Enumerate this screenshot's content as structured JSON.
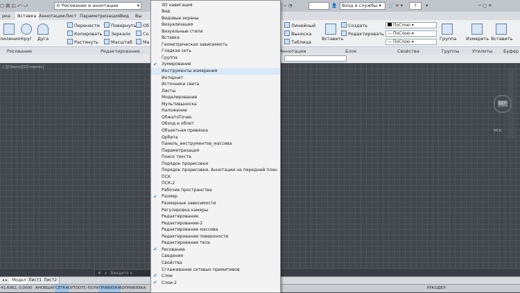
{
  "app": {
    "qat_left_tabs": [
      "рка",
      "Вставка",
      "Аннотации",
      "Лист",
      "Параметризация",
      "Вид",
      "Вы"
    ],
    "workspace": "Рисование и аннотации",
    "signin": "Вход в службы",
    "help": "?"
  },
  "ribbon": {
    "draw": {
      "polyline": "лилиния",
      "circle": "Круг",
      "arc": "Дуга"
    },
    "modify": {
      "move": "Перенести",
      "rotate": "Повернуть",
      "trim": "Об",
      "copy": "Копировать",
      "mirror": "Зеркало",
      "fillet": "Со",
      "stretch": "Растянуть",
      "scale": "Масштаб",
      "array": "Ма"
    },
    "annotation": {
      "linear": "Линейный",
      "leader": "Выноска",
      "table": "Таблица"
    },
    "block": {
      "insert": "Вставить",
      "create": "Создать",
      "edit": "Редактировать"
    },
    "properties": {
      "color": "ПоСлою",
      "linetype": "ПоСлою",
      "lineweight": "ПоСлою"
    },
    "groups": {
      "group": "Группа"
    },
    "utilities": {
      "measure": "Измерить"
    },
    "clipboard": {
      "paste": "Вставить"
    },
    "panels": {
      "draw": "Рисование",
      "modify": "Редактирование",
      "annotation": "Аннотации",
      "block": "Блок",
      "properties": "Свойства",
      "groups": "Группы",
      "utilities": "Утилиты",
      "clipboard": "Буфер о"
    }
  },
  "canvas": {
    "view_label": "[-][Сверху][2D-каркас]",
    "viewcube": "ВЕР",
    "wcs": "МСК"
  },
  "command_line": {
    "placeholder": "Введите к"
  },
  "layout_tabs": [
    "Модель",
    "Лист1",
    "Лист2"
  ],
  "status_bar": {
    "coords": "41,6962, 0,0000",
    "buttons": [
      "АНОВ",
      "ШАГ",
      "СЕТКА",
      "ОРТО",
      "ОТС-ПОЛЯР",
      "ПРИВЯЗКА",
      "3DПРИВЯЗКА"
    ],
    "active": [
      "СЕТКА",
      "ПРИВЯЗКА"
    ],
    "right": "РУКОДЕЛ"
  },
  "context_menu": {
    "items": [
      {
        "label": "3D навигация",
        "checked": false
      },
      {
        "label": "Вид",
        "checked": false
      },
      {
        "label": "Видовые экраны",
        "checked": false
      },
      {
        "label": "Визуализация",
        "checked": false
      },
      {
        "label": "Визуальные стили",
        "checked": false
      },
      {
        "label": "Вставка",
        "checked": false
      },
      {
        "label": "Геометрическая зависимость",
        "checked": false
      },
      {
        "label": "Гладкая сеть",
        "checked": false
      },
      {
        "label": "Группа",
        "checked": false
      },
      {
        "label": "Зумирование",
        "checked": true
      },
      {
        "label": "Инструменты измерения",
        "checked": false
      },
      {
        "label": "Интернет",
        "checked": false
      },
      {
        "label": "Источники света",
        "checked": false
      },
      {
        "label": "Листы",
        "checked": false
      },
      {
        "label": "Моделирование",
        "checked": false
      },
      {
        "label": "Мультивыноска",
        "checked": false
      },
      {
        "label": "Наложение",
        "checked": false
      },
      {
        "label": "ОбжатоТочек",
        "checked": false
      },
      {
        "label": "Обход и облет",
        "checked": false
      },
      {
        "label": "Объектная привязка",
        "checked": false
      },
      {
        "label": "Орбита",
        "checked": false
      },
      {
        "label": "Панель_инструментов_массива",
        "checked": false
      },
      {
        "label": "Параметризация",
        "checked": false
      },
      {
        "label": "Поиск текста",
        "checked": false
      },
      {
        "label": "Порядок прорисовки",
        "checked": false
      },
      {
        "label": "Порядок прорисовки, Аннотации на передний план",
        "checked": false
      },
      {
        "label": "ПСК",
        "checked": false
      },
      {
        "label": "ПСК-2",
        "checked": false
      },
      {
        "label": "Рабочие пространства",
        "checked": false
      },
      {
        "label": "Размер",
        "checked": true
      },
      {
        "label": "Размерные зависимости",
        "checked": false
      },
      {
        "label": "Регулировка камеры",
        "checked": false
      },
      {
        "label": "Редактирование",
        "checked": false
      },
      {
        "label": "Редактирование-2",
        "checked": false
      },
      {
        "label": "Редактирование массива",
        "checked": false
      },
      {
        "label": "Редактирование поверхности",
        "checked": false
      },
      {
        "label": "Редактирование тела",
        "checked": false
      },
      {
        "label": "Рисование",
        "checked": true
      },
      {
        "label": "Сведения",
        "checked": false
      },
      {
        "label": "Свойства",
        "checked": false
      },
      {
        "label": "Сглаживание сетевых примитивов",
        "checked": false
      },
      {
        "label": "Слои",
        "checked": true
      },
      {
        "label": "Слои-2",
        "checked": true
      }
    ]
  }
}
